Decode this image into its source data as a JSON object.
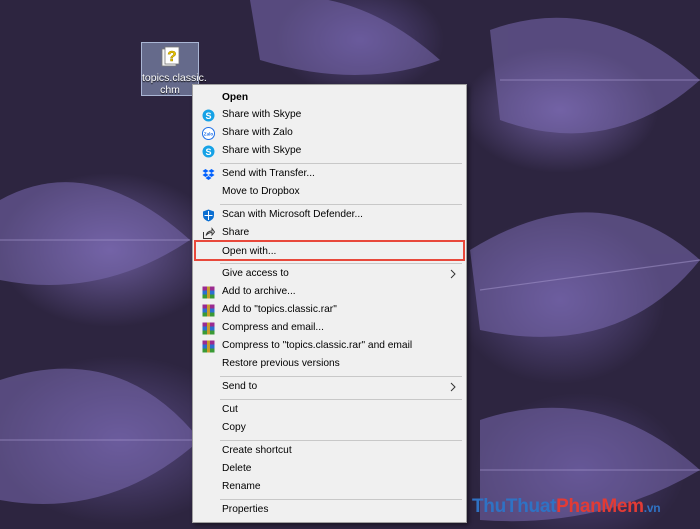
{
  "desktop": {
    "file": {
      "name": "topics.classic.chm",
      "label_line1": "topics.classic.",
      "label_line2": "chm",
      "icon": "chm-help-icon"
    }
  },
  "context_menu": {
    "items": [
      {
        "label": "Open",
        "bold": true,
        "icon": ""
      },
      {
        "label": "Share with Skype",
        "icon": "skype-icon"
      },
      {
        "label": "Share with Zalo",
        "icon": "zalo-icon"
      },
      {
        "label": "Share with Skype",
        "icon": "skype-icon"
      },
      {
        "label": "Send with Transfer...",
        "icon": "dropbox-icon"
      },
      {
        "label": "Move to Dropbox",
        "icon": ""
      },
      {
        "label": "Scan with Microsoft Defender...",
        "icon": "defender-shield-icon"
      },
      {
        "label": "Share",
        "icon": "share-icon"
      },
      {
        "label": "Open with...",
        "icon": "",
        "highlighted": true
      },
      {
        "label": "Give access to",
        "icon": "",
        "submenu": true
      },
      {
        "label": "Add to archive...",
        "icon": "winrar-icon"
      },
      {
        "label": "Add to \"topics.classic.rar\"",
        "icon": "winrar-icon"
      },
      {
        "label": "Compress and email...",
        "icon": "winrar-icon"
      },
      {
        "label": "Compress to \"topics.classic.rar\" and email",
        "icon": "winrar-icon"
      },
      {
        "label": "Restore previous versions",
        "icon": ""
      },
      {
        "label": "Send to",
        "icon": "",
        "submenu": true
      },
      {
        "label": "Cut",
        "icon": ""
      },
      {
        "label": "Copy",
        "icon": ""
      },
      {
        "label": "Create shortcut",
        "icon": ""
      },
      {
        "label": "Delete",
        "icon": ""
      },
      {
        "label": "Rename",
        "icon": ""
      },
      {
        "label": "Properties",
        "icon": ""
      }
    ]
  },
  "highlight_color": "#e8483b",
  "watermark": {
    "part1": "ThuThuat",
    "part2": "PhanMem",
    "part3": ".vn"
  }
}
